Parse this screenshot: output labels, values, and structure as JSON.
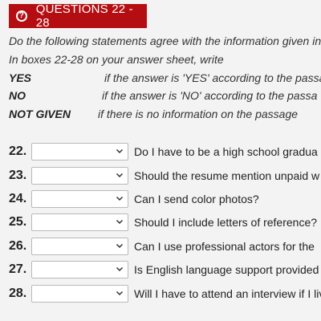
{
  "header": {
    "title": "QUESTIONS 22 - 28",
    "icon": "question-circle-icon",
    "accent_color": "#b40e12"
  },
  "instructions": {
    "line1": "Do the following statements agree with the information given in",
    "line2": "In boxes 22-28 on your answer sheet, write"
  },
  "legend": [
    {
      "key": "YES",
      "desc": "if the answer is 'YES' according to the passa"
    },
    {
      "key": "NO",
      "desc": "if the answer is 'NO' according to the passa"
    },
    {
      "key": "NOT GIVEN",
      "desc": "if there is no information on the passage"
    }
  ],
  "questions": [
    {
      "number": "22.",
      "selected": "",
      "text": "Do I have to be a high school gradua"
    },
    {
      "number": "23.",
      "selected": "",
      "text": "Should the resume mention unpaid w"
    },
    {
      "number": "24.",
      "selected": "",
      "text": "Can I send color photos?"
    },
    {
      "number": "25.",
      "selected": "",
      "text": "Should I include letters of reference?"
    },
    {
      "number": "26.",
      "selected": "",
      "text": "Can I use professional actors for the"
    },
    {
      "number": "27.",
      "selected": "",
      "text": "Is English language support provided"
    },
    {
      "number": "28.",
      "selected": "",
      "text": "Will I have to attend an interview if I liv"
    }
  ]
}
